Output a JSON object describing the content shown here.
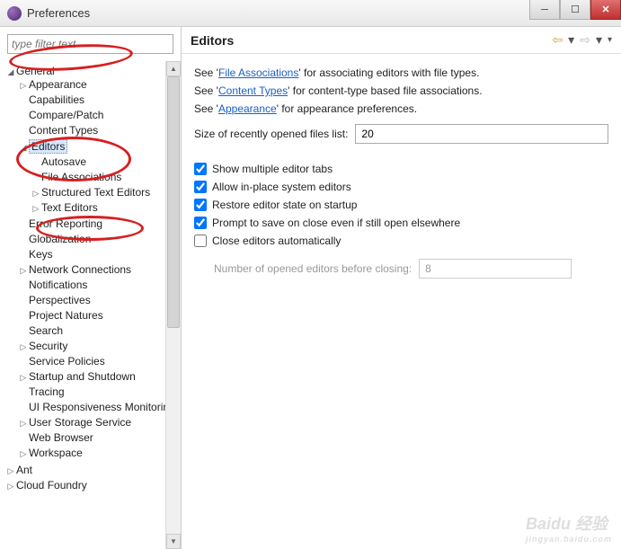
{
  "window": {
    "title": "Preferences"
  },
  "filter": {
    "placeholder": "type filter text"
  },
  "tree": {
    "general": "General",
    "appearance": "Appearance",
    "capabilities": "Capabilities",
    "compare": "Compare/Patch",
    "contentTypes": "Content Types",
    "editors": "Editors",
    "autosave": "Autosave",
    "fileAssoc": "File Associations",
    "structured": "Structured Text Editors",
    "textEditors": "Text Editors",
    "errorRep": "Error Reporting",
    "globalization": "Globalization",
    "keys": "Keys",
    "network": "Network Connections",
    "notifications": "Notifications",
    "perspectives": "Perspectives",
    "projectNatures": "Project Natures",
    "search": "Search",
    "security": "Security",
    "servicePolicies": "Service Policies",
    "startup": "Startup and Shutdown",
    "tracing": "Tracing",
    "uiResp": "UI Responsiveness Monitoring",
    "userStorage": "User Storage Service",
    "webBrowser": "Web Browser",
    "workspace": "Workspace",
    "ant": "Ant",
    "cloud": "Cloud Foundry"
  },
  "header": {
    "title": "Editors"
  },
  "intro": {
    "line1a": "See '",
    "link1": "File Associations",
    "line1b": "' for associating editors with file types.",
    "line2a": "See '",
    "link2": "Content Types",
    "line2b": "' for content-type based file associations.",
    "line3a": "See '",
    "link3": "Appearance",
    "line3b": "' for appearance preferences."
  },
  "form": {
    "recentLabel": "Size of recently opened files list:",
    "recentValue": "20",
    "chk1": "Show multiple editor tabs",
    "chk2": "Allow in-place system editors",
    "chk3": "Restore editor state on startup",
    "chk4": "Prompt to save on close even if still open elsewhere",
    "chk5": "Close editors automatically",
    "subLabel": "Number of opened editors before closing:",
    "subValue": "8"
  },
  "watermark": {
    "brand": "Baidu 经验",
    "url": "jingyan.baidu.com"
  }
}
